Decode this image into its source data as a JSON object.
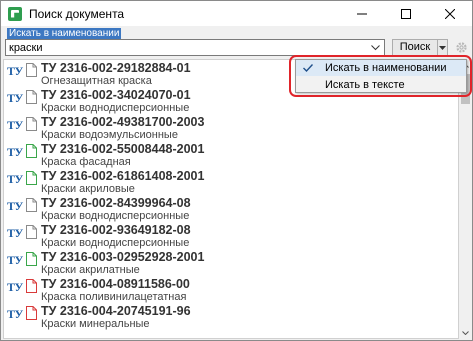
{
  "window": {
    "title": "Поиск документа"
  },
  "search": {
    "mode_label": "Искать в наименовании",
    "query": "краски",
    "button_label": "Поиск"
  },
  "menu": {
    "items": [
      {
        "label": "Искать в наименовании",
        "checked": true
      },
      {
        "label": "Искать в тексте",
        "checked": false
      }
    ]
  },
  "results": [
    {
      "badge": "ТУ",
      "code": "ТУ 2316-002-29182884-01",
      "name": "Огнезащитная краска",
      "doc_color": "#8a8a8a"
    },
    {
      "badge": "ТУ",
      "code": "ТУ 2316-002-34024070-01",
      "name": "Краски воднодисперсионные",
      "doc_color": "#8a8a8a"
    },
    {
      "badge": "ТУ",
      "code": "ТУ 2316-002-49381700-2003",
      "name": "Краски водоэмульсионные",
      "doc_color": "#8a8a8a"
    },
    {
      "badge": "ТУ",
      "code": "ТУ 2316-002-55008448-2001",
      "name": "Краска фасадная",
      "doc_color": "#3aa64a"
    },
    {
      "badge": "ТУ",
      "code": "ТУ 2316-002-61861408-2001",
      "name": "Краски акриловые",
      "doc_color": "#3aa64a"
    },
    {
      "badge": "ТУ",
      "code": "ТУ 2316-002-84399964-08",
      "name": "Краски воднодисперсионные",
      "doc_color": "#8a8a8a"
    },
    {
      "badge": "ТУ",
      "code": "ТУ 2316-002-93649182-08",
      "name": "Краски воднодисперсионные",
      "doc_color": "#8a8a8a"
    },
    {
      "badge": "ТУ",
      "code": "ТУ 2316-003-02952928-2001",
      "name": "Краски акрилатные",
      "doc_color": "#3aa64a"
    },
    {
      "badge": "ТУ",
      "code": "ТУ 2316-004-08911586-00",
      "name": "Краска поливинилацетатная",
      "doc_color": "#d93a3a"
    },
    {
      "badge": "ТУ",
      "code": "ТУ 2316-004-20745191-96",
      "name": "Краски минеральные",
      "doc_color": "#d93a3a"
    }
  ],
  "colors": {
    "accent": "#3d78c2",
    "highlight": "#e0242a",
    "badge": "#1f5fa6"
  }
}
